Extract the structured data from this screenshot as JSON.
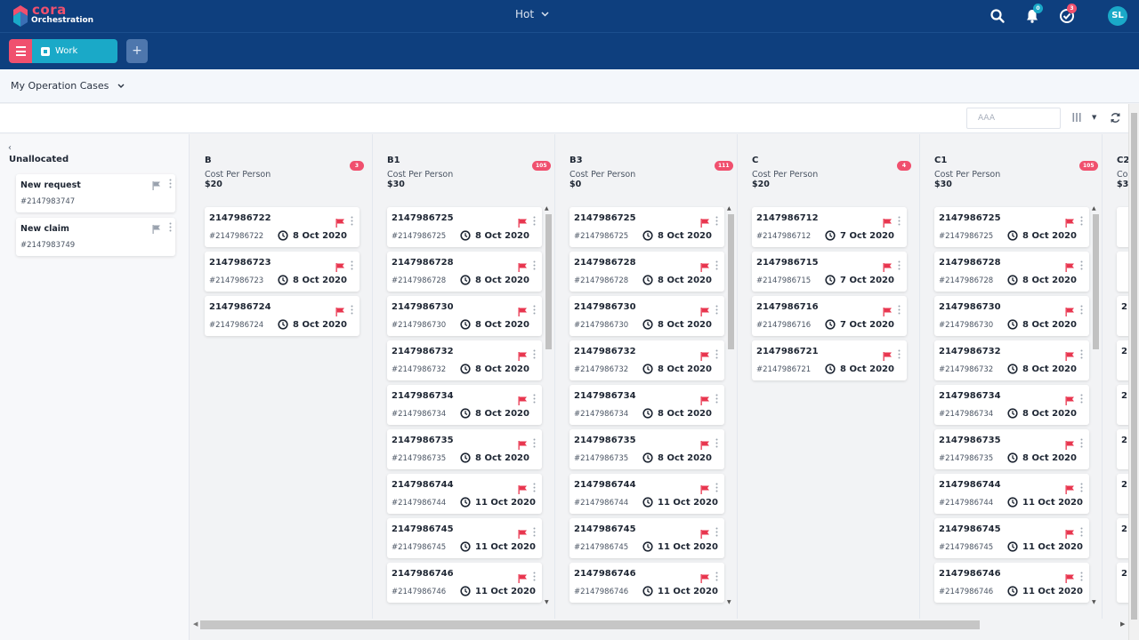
{
  "app": {
    "brand_name": "cora",
    "brand_sub": "Orchestration",
    "view_selector": "Hot",
    "notifications_count": "0",
    "tasks_count": "3",
    "avatar_initials": "SL",
    "colors": {
      "navbar": "#0e3f7e",
      "accent_pink": "#f0506e",
      "accent_teal": "#1aa9c8"
    }
  },
  "toolbar": {
    "work_tab_label": "Work",
    "add_tab_label": "+"
  },
  "header": {
    "list_selector": "My Operation Cases"
  },
  "filters": {
    "search_value": "AAA"
  },
  "unallocated": {
    "title": "Unallocated",
    "cards": [
      {
        "title": "New request",
        "ref": "#2147983747"
      },
      {
        "title": "New claim",
        "ref": "#2147983749"
      }
    ]
  },
  "columns": [
    {
      "name": "B",
      "count": "3",
      "cost_label": "Cost Per Person",
      "cost": "$20",
      "cards": [
        {
          "id": "2147986722",
          "ref": "#2147986722",
          "date": "8 Oct 2020"
        },
        {
          "id": "2147986723",
          "ref": "#2147986723",
          "date": "8 Oct 2020"
        },
        {
          "id": "2147986724",
          "ref": "#2147986724",
          "date": "8 Oct 2020"
        }
      ]
    },
    {
      "name": "B1",
      "count": "105",
      "cost_label": "Cost Per Person",
      "cost": "$30",
      "cards": [
        {
          "id": "2147986725",
          "ref": "#2147986725",
          "date": "8 Oct 2020"
        },
        {
          "id": "2147986728",
          "ref": "#2147986728",
          "date": "8 Oct 2020"
        },
        {
          "id": "2147986730",
          "ref": "#2147986730",
          "date": "8 Oct 2020"
        },
        {
          "id": "2147986732",
          "ref": "#2147986732",
          "date": "8 Oct 2020"
        },
        {
          "id": "2147986734",
          "ref": "#2147986734",
          "date": "8 Oct 2020"
        },
        {
          "id": "2147986735",
          "ref": "#2147986735",
          "date": "8 Oct 2020"
        },
        {
          "id": "2147986744",
          "ref": "#2147986744",
          "date": "11 Oct 2020"
        },
        {
          "id": "2147986745",
          "ref": "#2147986745",
          "date": "11 Oct 2020"
        },
        {
          "id": "2147986746",
          "ref": "#2147986746",
          "date": "11 Oct 2020"
        }
      ]
    },
    {
      "name": "B3",
      "count": "111",
      "cost_label": "Cost Per Person",
      "cost": "$0",
      "cards": [
        {
          "id": "2147986725",
          "ref": "#2147986725",
          "date": "8 Oct 2020"
        },
        {
          "id": "2147986728",
          "ref": "#2147986728",
          "date": "8 Oct 2020"
        },
        {
          "id": "2147986730",
          "ref": "#2147986730",
          "date": "8 Oct 2020"
        },
        {
          "id": "2147986732",
          "ref": "#2147986732",
          "date": "8 Oct 2020"
        },
        {
          "id": "2147986734",
          "ref": "#2147986734",
          "date": "8 Oct 2020"
        },
        {
          "id": "2147986735",
          "ref": "#2147986735",
          "date": "8 Oct 2020"
        },
        {
          "id": "2147986744",
          "ref": "#2147986744",
          "date": "11 Oct 2020"
        },
        {
          "id": "2147986745",
          "ref": "#2147986745",
          "date": "11 Oct 2020"
        },
        {
          "id": "2147986746",
          "ref": "#2147986746",
          "date": "11 Oct 2020"
        }
      ]
    },
    {
      "name": "C",
      "count": "4",
      "cost_label": "Cost Per Person",
      "cost": "$20",
      "cards": [
        {
          "id": "2147986712",
          "ref": "#2147986712",
          "date": "7 Oct 2020"
        },
        {
          "id": "2147986715",
          "ref": "#2147986715",
          "date": "7 Oct 2020"
        },
        {
          "id": "2147986716",
          "ref": "#2147986716",
          "date": "7 Oct 2020"
        },
        {
          "id": "2147986721",
          "ref": "#2147986721",
          "date": "8 Oct 2020"
        }
      ]
    },
    {
      "name": "C1",
      "count": "105",
      "cost_label": "Cost Per Person",
      "cost": "$30",
      "cards": [
        {
          "id": "2147986725",
          "ref": "#2147986725",
          "date": "8 Oct 2020"
        },
        {
          "id": "2147986728",
          "ref": "#2147986728",
          "date": "8 Oct 2020"
        },
        {
          "id": "2147986730",
          "ref": "#2147986730",
          "date": "8 Oct 2020"
        },
        {
          "id": "2147986732",
          "ref": "#2147986732",
          "date": "8 Oct 2020"
        },
        {
          "id": "2147986734",
          "ref": "#2147986734",
          "date": "8 Oct 2020"
        },
        {
          "id": "2147986735",
          "ref": "#2147986735",
          "date": "8 Oct 2020"
        },
        {
          "id": "2147986744",
          "ref": "#2147986744",
          "date": "11 Oct 2020"
        },
        {
          "id": "2147986745",
          "ref": "#2147986745",
          "date": "11 Oct 2020"
        },
        {
          "id": "2147986746",
          "ref": "#2147986746",
          "date": "11 Oct 2020"
        }
      ]
    },
    {
      "name": "C2",
      "count": "",
      "cost_label": "Co",
      "cost": "$3",
      "cards": [
        {
          "id": "",
          "ref": "",
          "date": ""
        },
        {
          "id": "",
          "ref": "",
          "date": ""
        },
        {
          "id": "2",
          "ref": "",
          "date": ""
        },
        {
          "id": "2",
          "ref": "",
          "date": ""
        },
        {
          "id": "2",
          "ref": "",
          "date": ""
        },
        {
          "id": "2",
          "ref": "",
          "date": ""
        },
        {
          "id": "2",
          "ref": "",
          "date": ""
        },
        {
          "id": "2",
          "ref": "",
          "date": ""
        },
        {
          "id": "2",
          "ref": "",
          "date": ""
        }
      ]
    }
  ]
}
